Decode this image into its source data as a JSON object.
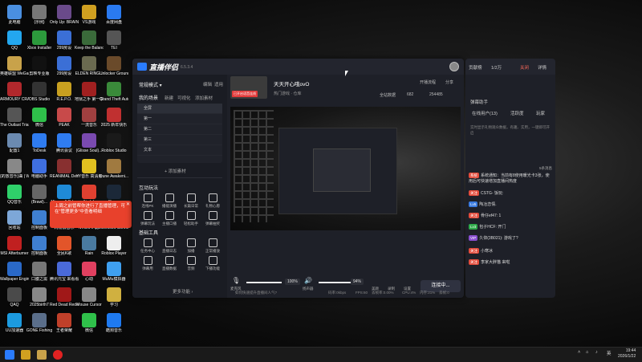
{
  "desktop": {
    "icons": [
      {
        "label": "此电脑",
        "color": "#4a8fe0"
      },
      {
        "label": "QQ",
        "color": "#23a7ef"
      },
      {
        "label": "英雄联盟 WeGame版",
        "color": "#c8a24a"
      },
      {
        "label": "ARMOURY CRATE",
        "color": "#b0282c"
      },
      {
        "label": "The Outlast Trials",
        "color": "#555"
      },
      {
        "label": "配置1",
        "color": "#6b8ab0"
      },
      {
        "label": "{的放音乐}曲 | WA47...",
        "color": "#888"
      },
      {
        "label": "QQ音乐",
        "color": "#2fd06a"
      },
      {
        "label": "回收站",
        "color": "#7da7d8"
      },
      {
        "label": "MSI Afterburner",
        "color": "#c02020"
      },
      {
        "label": "Wallpaper Engine:...",
        "color": "#2a69c8"
      },
      {
        "label": "QAQ",
        "color": "#4a4a4a"
      },
      {
        "label": "UU加速器",
        "color": "#1c9be0"
      },
      {
        "label": "{示例}",
        "color": "#777"
      },
      {
        "label": "Xbox Installer",
        "color": "#2c9a3c"
      },
      {
        "label": "剪映专业版",
        "color": "#111"
      },
      {
        "label": "OBS Studio",
        "color": "#333"
      },
      {
        "label": "微信",
        "color": "#2fc04a"
      },
      {
        "label": "ToDesk",
        "color": "#2f7cf0"
      },
      {
        "label": "电脑助手",
        "color": "#3f6fe0"
      },
      {
        "label": "(Brawl)...",
        "color": "#666"
      },
      {
        "label": "控制面板",
        "color": "#3f7fd0"
      },
      {
        "label": "控制面板",
        "color": "#3f7fd0"
      },
      {
        "label": "口腹之需",
        "color": "#777"
      },
      {
        "label": "2025birth7",
        "color": "#888"
      },
      {
        "label": "GONE Fishing",
        "color": "#5a6e8a"
      },
      {
        "label": "Only Up: BRAINR...",
        "color": "#6a4a8a"
      },
      {
        "label": "299房设",
        "color": "#3b6fd6"
      },
      {
        "label": "299房设",
        "color": "#3b6fd6"
      },
      {
        "label": "R.E.P.O.",
        "color": "#c8a020"
      },
      {
        "label": "PEAK",
        "color": "#c84a4a"
      },
      {
        "label": "腾讯会议",
        "color": "#2f7cf0"
      },
      {
        "label": "REANIMAL Demo",
        "color": "#883030"
      },
      {
        "label": "Microsoft Edge",
        "color": "#1f8ad6"
      },
      {
        "label": "网易云音乐",
        "color": "#e22222"
      },
      {
        "label": "全民K歌",
        "color": "#e2552a"
      },
      {
        "label": "腾讯元宝 来看看 畅玩...",
        "color": "#4a6ad8"
      },
      {
        "label": "Red Dead Redempt...",
        "color": "#a01818"
      },
      {
        "label": "王者荣耀",
        "color": "#c0402a"
      },
      {
        "label": "VS游戏",
        "color": "#d0a020"
      },
      {
        "label": "Keep the Balance",
        "color": "#3a6a3a"
      },
      {
        "label": "ELDEN RING...",
        "color": "#6a6a50"
      },
      {
        "label": "地狱之手 第一季",
        "color": "#a02020"
      },
      {
        "label": "一流音乐",
        "color": "#a04040"
      },
      {
        "label": "(Glisse Soul)...",
        "color": "#7a4ab0"
      },
      {
        "label": "YY音乐 高清版",
        "color": "#e0c020"
      },
      {
        "label": "Aimlab",
        "color": "#e04030"
      },
      {
        "label": "NVIDIA App",
        "color": "#76b900"
      },
      {
        "label": "Rain",
        "color": "#4a7aa0"
      },
      {
        "label": "心动",
        "color": "#e04060"
      },
      {
        "label": "Mouse Cursor",
        "color": "#888"
      },
      {
        "label": "微信",
        "color": "#2fc04a"
      },
      {
        "label": "百度网盘",
        "color": "#2a7af0"
      },
      {
        "label": "TEI",
        "color": "#555"
      },
      {
        "label": "Unlocker Grounds",
        "color": "#6a4a2a"
      },
      {
        "label": "Grand Theft Auto V",
        "color": "#3a8a3a"
      },
      {
        "label": "2025 新年快乐",
        "color": "#c03030"
      },
      {
        "label": "Roblox Studio",
        "color": "#1a1a1a"
      },
      {
        "label": "Dune Awakeni...",
        "color": "#a07a40"
      },
      {
        "label": "Steam",
        "color": "#1b2838"
      },
      {
        "label": "Microsoft Connect",
        "color": "#1f8ad6"
      },
      {
        "label": "Roblox Player",
        "color": "#eee"
      },
      {
        "label": "MuMu模拟器",
        "color": "#3fa0f0"
      },
      {
        "label": "学习",
        "color": "#d0b040"
      },
      {
        "label": "酷狗音乐",
        "color": "#1f7af0"
      }
    ]
  },
  "toast": {
    "text": "上周之前管帮你进行了直播管理，可在\"管理更多\"中查看明细",
    "close": "✕"
  },
  "app": {
    "brand": "直播伴侣",
    "version": "6.5.3.4",
    "mode_label": "常规模式 ▾",
    "edit_label": "编辑",
    "tutorial_label": "适用",
    "scene_header": "我的场景",
    "scene_links": [
      "新建",
      "可视化",
      "添加素材"
    ],
    "scenes": [
      "全屏",
      "第一",
      "第二",
      "第三",
      "文本"
    ],
    "add_source": "+ 添加素材",
    "interact_header": "互动玩法",
    "interact_items": [
      {
        "label": "连线PK"
      },
      {
        "label": "播能演播"
      },
      {
        "label": "长篇日常"
      },
      {
        "label": "礼物心愿"
      },
      {
        "label": "弹幕玩法"
      },
      {
        "label": "主播口播"
      },
      {
        "label": "轻松助手"
      },
      {
        "label": "弹幕抽奖"
      }
    ],
    "tools_header": "基础工具",
    "tools_items": [
      {
        "label": "任务中心"
      },
      {
        "label": "直播日志"
      },
      {
        "label": "加播"
      },
      {
        "label": "正常播放"
      },
      {
        "label": "弹幕用"
      },
      {
        "label": "直播数据"
      },
      {
        "label": "音频"
      },
      {
        "label": "下播功能"
      }
    ],
    "more_label": "更多功能 ›",
    "room_title": "天天开心哦ovO",
    "room_tag": "已开启语音连线",
    "room_sub": "热门游戏 · 仓库",
    "live_status": "开播流程",
    "share": "分享",
    "all_data": "全站数据",
    "viewers": "682",
    "likes": "254485",
    "mic_label": "麦克风",
    "mic_pct": "100%",
    "speaker_label": "扬声器",
    "speaker_pct": "94%",
    "effect_label": "美颜",
    "record_label": "录制",
    "settings_label": "设置",
    "connect_label": "连接中...",
    "status_hint": "如何快速提升直播间人气?",
    "status_items": [
      "码率:0kbps",
      "FPS:60",
      "丢帧率:0.00%",
      "CPU:4%",
      "内存:21%",
      "丢帧:0"
    ]
  },
  "chat": {
    "top_tabs": [
      "贡献榜",
      "1/2万"
    ],
    "close_label": "关闭",
    "detail_label": "详情",
    "sub_title": "弹幕助手",
    "tabs": [
      "在线用户(13)",
      "活跃度",
      "玩家"
    ],
    "hint": "实时显示礼物观众数据，有趣、实用，一键即可开启",
    "online_count": "5条消息",
    "messages": [
      {
        "badge": "系统",
        "color": "#e34b3b",
        "text": "系统通知：当前有8使用暖光卡3张，使用后可快速增加直播间热度"
      },
      {
        "badge": "关注",
        "color": "#e34b3b",
        "text": "CSTG- 饭玩:"
      },
      {
        "badge": "Lv5",
        "color": "#3a7be0",
        "text": "陶冶恋情."
      },
      {
        "badge": "关注",
        "color": "#e34b3b",
        "text": "骨仔ef47: 1"
      },
      {
        "badge": "Lv3",
        "color": "#2faa4a",
        "text": "包子HCF: 开门"
      },
      {
        "badge": "VIP",
        "color": "#8a4fd0",
        "text": "久仰(3B021): 游戏了?"
      },
      {
        "badge": "关注",
        "color": "#e34b3b",
        "text": "小寒冰"
      },
      {
        "badge": "关注",
        "color": "#e34b3b",
        "text": "李家大胖猫 来啦"
      }
    ]
  },
  "taskbar": {
    "tray_lang": "英",
    "time": "19:44",
    "date": "2026/1/22"
  }
}
